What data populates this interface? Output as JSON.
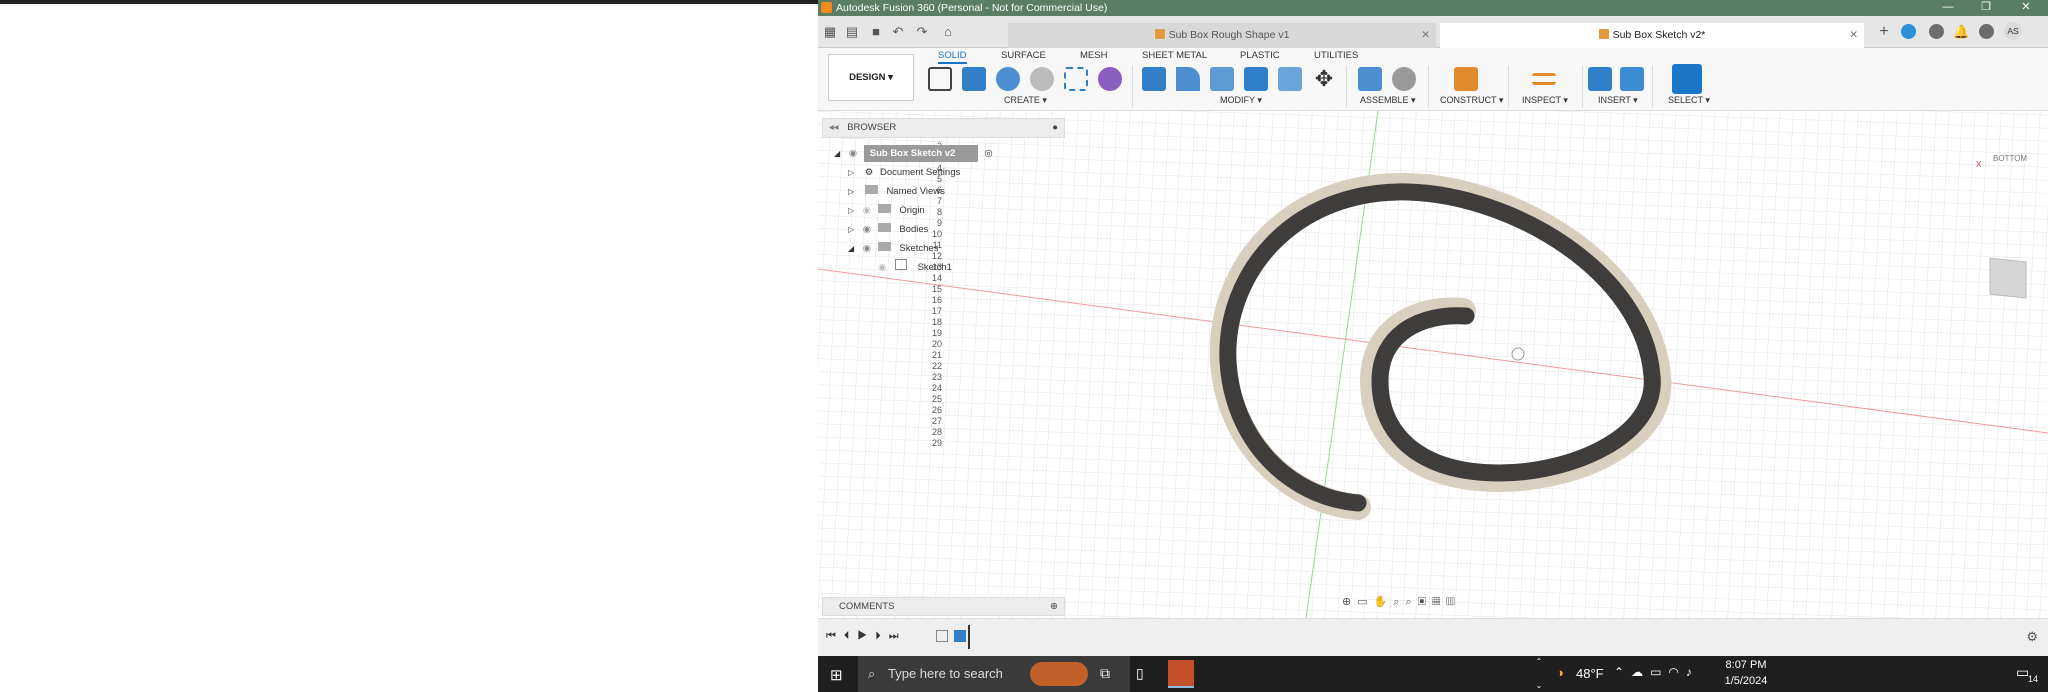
{
  "window": {
    "title": "Autodesk Fusion 360 (Personal - Not for Commercial Use)"
  },
  "tabs": [
    {
      "label": "Sub Box Rough Shape v1"
    },
    {
      "label": "Sub Box Sketch v2*"
    }
  ],
  "user": {
    "initials": "AS"
  },
  "toolbar": {
    "design_label": "DESIGN ▾",
    "workspace_tabs": [
      "SOLID",
      "SURFACE",
      "MESH",
      "SHEET METAL",
      "PLASTIC",
      "UTILITIES"
    ],
    "groups": [
      "CREATE ▾",
      "MODIFY ▾",
      "ASSEMBLE ▾",
      "CONSTRUCT ▾",
      "INSPECT ▾",
      "INSERT ▾",
      "SELECT ▾"
    ]
  },
  "browser": {
    "title": "BROWSER",
    "root": "Sub Box Sketch v2",
    "items": [
      "Document Settings",
      "Named Views",
      "Origin",
      "Bodies",
      "Sketches"
    ],
    "sketch": "Sketch1"
  },
  "comments": {
    "title": "COMMENTS"
  },
  "viewcube": {
    "label": "BOTTOM",
    "axis_x": "X"
  },
  "ruler_numbers": [
    "2",
    "3",
    "4",
    "5",
    "6",
    "7",
    "8",
    "9",
    "10",
    "11",
    "12",
    "13",
    "14",
    "15",
    "16",
    "17",
    "18",
    "19",
    "20",
    "21",
    "22",
    "23",
    "24",
    "25",
    "26",
    "27",
    "28",
    "29"
  ],
  "taskbar": {
    "search_placeholder": "Type here to search",
    "temperature": "48°F",
    "time": "8:07 PM",
    "date": "1/5/2024",
    "notifications": "14"
  },
  "colors": {
    "titlebar": "#5a7d65",
    "accent": "#1a76c9",
    "solid_body": "#3f3d3b",
    "solid_edge": "#d9cfbf"
  }
}
